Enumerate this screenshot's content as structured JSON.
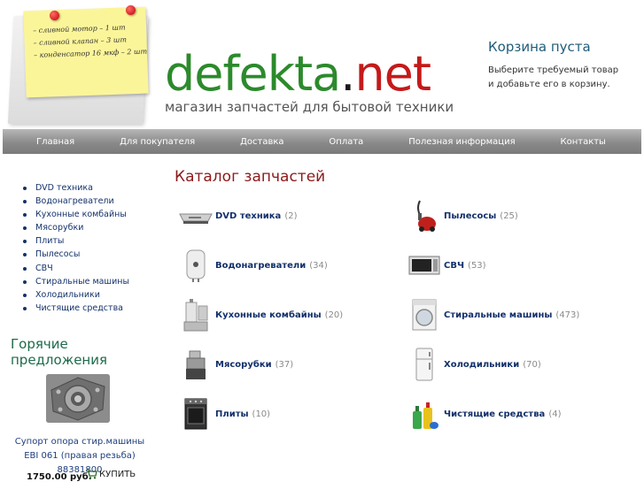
{
  "header": {
    "logo_part1": "defekta",
    "logo_part2": ".",
    "logo_part3": "net",
    "tagline": "магазин запчастей для бытовой техники",
    "note_lines": [
      "– сливной мотор – 1 шт",
      "– сливной клапан – 3 шт",
      "– конденсатор 16 мкф – 2 шт"
    ]
  },
  "cart": {
    "title": "Корзина пуста",
    "line1": "Выберите требуемый товар",
    "line2": "и добавьте его в корзину."
  },
  "nav": [
    "Главная",
    "Для покупателя",
    "Доставка",
    "Оплата",
    "Полезная информация",
    "Контакты"
  ],
  "sidebar": {
    "categories": [
      "DVD техника",
      "Водонагреватели",
      "Кухонные комбайны",
      "Мясорубки",
      "Плиты",
      "Пылесосы",
      "СВЧ",
      "Стиральные машины",
      "Холодильники",
      "Чистящие средства"
    ],
    "hot_title_line1": "Горячие",
    "hot_title_line2": "предложения",
    "hot_desc": "Супорт опора стир.машины EBI 061 (правая резьба) 88381800",
    "hot_price": "1750.00 руб.",
    "buy_label": "КУПИТЬ"
  },
  "catalog": {
    "title": "Каталог запчастей",
    "items": [
      {
        "label": "DVD техника",
        "count": "(2)",
        "icon": "dvd-player-icon"
      },
      {
        "label": "Пылесосы",
        "count": "(25)",
        "icon": "vacuum-cleaner-icon"
      },
      {
        "label": "Водонагреватели",
        "count": "(34)",
        "icon": "water-heater-icon"
      },
      {
        "label": "СВЧ",
        "count": "(53)",
        "icon": "microwave-icon"
      },
      {
        "label": "Кухонные комбайны",
        "count": "(20)",
        "icon": "food-processor-icon"
      },
      {
        "label": "Стиральные машины",
        "count": "(473)",
        "icon": "washing-machine-icon"
      },
      {
        "label": "Мясорубки",
        "count": "(37)",
        "icon": "meat-grinder-icon"
      },
      {
        "label": "Холодильники",
        "count": "(70)",
        "icon": "refrigerator-icon"
      },
      {
        "label": "Плиты",
        "count": "(10)",
        "icon": "stove-icon"
      },
      {
        "label": "Чистящие средства",
        "count": "(4)",
        "icon": "cleaning-products-icon"
      }
    ]
  }
}
